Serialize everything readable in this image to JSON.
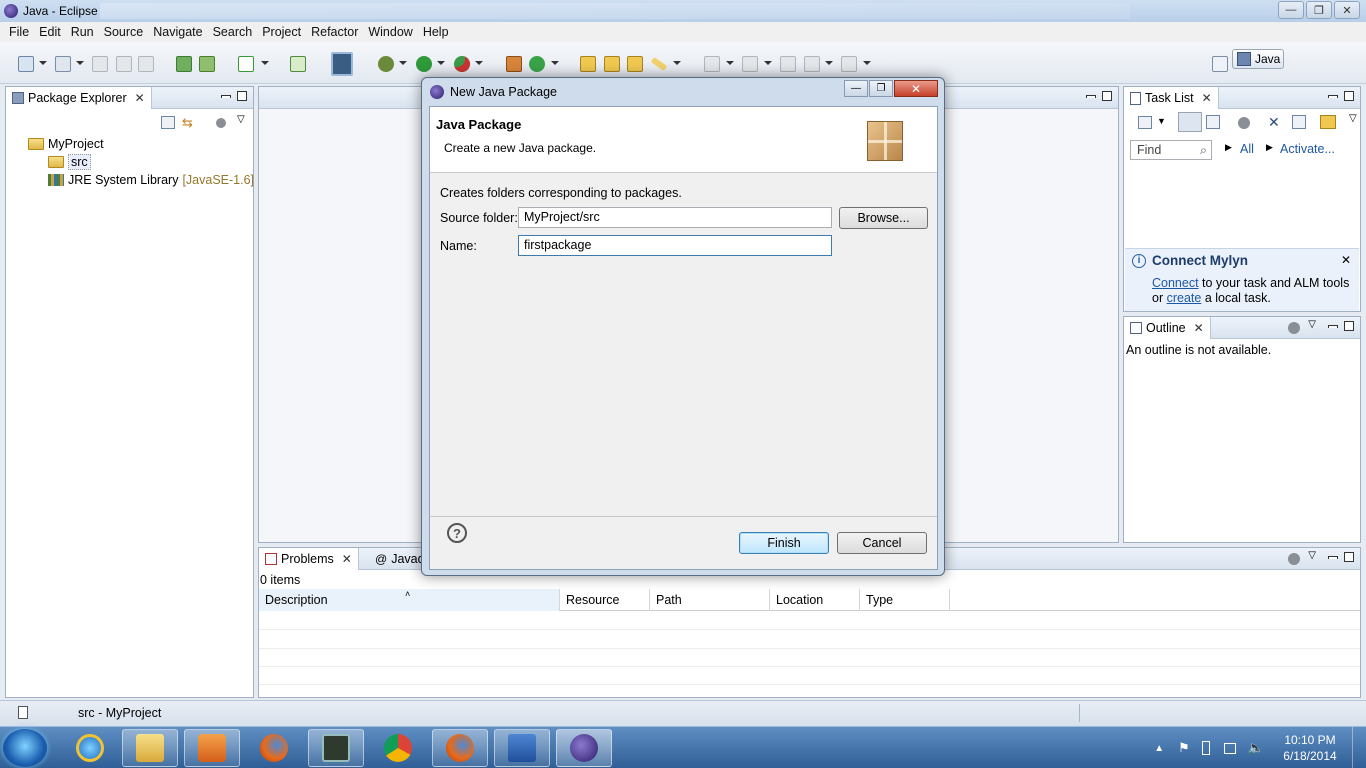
{
  "window": {
    "title": "Java - Eclipse"
  },
  "menu": [
    "File",
    "Edit",
    "Run",
    "Source",
    "Navigate",
    "Search",
    "Project",
    "Refactor",
    "Window",
    "Help"
  ],
  "perspective": {
    "label": "Java"
  },
  "package_explorer": {
    "tab": "Package Explorer",
    "tree": [
      {
        "label": "MyProject",
        "suffix": ""
      },
      {
        "label": "src",
        "suffix": ""
      },
      {
        "label": "JRE System Library",
        "suffix": "[JavaSE-1.6]"
      }
    ]
  },
  "task_list": {
    "tab": "Task List",
    "find_placeholder": "Find",
    "all_link": "All",
    "activate_link": "Activate...",
    "mylyn_title": "Connect Mylyn",
    "mylyn_text_1_link": "Connect",
    "mylyn_text_1_rest": " to your task and ALM tools",
    "mylyn_text_2_pre": "or ",
    "mylyn_text_2_link": "create",
    "mylyn_text_2_rest": " a local task."
  },
  "outline": {
    "tab": "Outline",
    "message": "An outline is not available."
  },
  "problems": {
    "tab": "Problems",
    "tab2": "Javad",
    "count": "0 items",
    "columns": [
      "Description",
      "Resource",
      "Path",
      "Location",
      "Type"
    ]
  },
  "dialog": {
    "title": "New Java Package",
    "banner_title": "Java Package",
    "banner_subtitle": "Create a new Java package.",
    "info": "Creates folders corresponding to packages.",
    "source_label": "Source folder:",
    "source_value": "MyProject/src",
    "browse": "Browse...",
    "name_label": "Name:",
    "name_value": "firstpackage",
    "finish": "Finish",
    "cancel": "Cancel",
    "help": "?"
  },
  "status": {
    "text": "src - MyProject"
  },
  "taskbar": {
    "time": "10:10 PM",
    "date": "6/18/2014"
  }
}
